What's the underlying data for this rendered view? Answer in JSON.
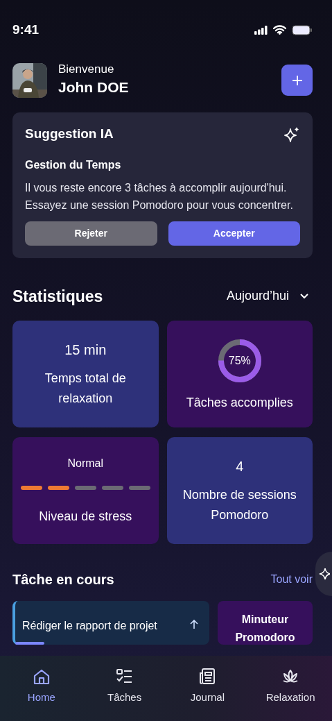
{
  "status_bar": {
    "time": "9:41"
  },
  "header": {
    "greeting": "Bienvenue",
    "name": "John DOE"
  },
  "suggestion": {
    "title": "Suggestion IA",
    "subtitle": "Gestion du Temps",
    "text": "Il vous reste encore 3 tâches à accomplir aujourd'hui. Essayez une session Pomodoro pour vous concentrer.",
    "buttons": [
      {
        "label": "Rejeter",
        "kind": "secondary"
      },
      {
        "label": "Accepter",
        "kind": "primary"
      }
    ]
  },
  "statistics": {
    "title": "Statistiques",
    "period": "Aujourd’hui",
    "cards": [
      {
        "kind": "value",
        "value": "15 min",
        "label": "Temps total de relaxation",
        "color": "#2e317a"
      },
      {
        "kind": "ring",
        "value": "75%",
        "label": "Tâches accomplies",
        "color": "#36105c"
      },
      {
        "kind": "segments",
        "value": "Normal",
        "level": 0.4,
        "label": "Niveau de stress",
        "color": "#36105c"
      },
      {
        "kind": "value",
        "value": "4",
        "label": "Nombre de sessions Pomodoro",
        "color": "#2e317a"
      }
    ]
  },
  "current_tasks": {
    "title": "Tâche en cours",
    "link": "Tout voir",
    "items": [
      {
        "kind": "task",
        "title": "Rédiger le rapport de projet",
        "level": 0.15
      },
      {
        "kind": "timer",
        "title": "Minuteur Promodoro"
      }
    ]
  },
  "bottom_nav": [
    {
      "label": "Home",
      "selected": true
    },
    {
      "label": "Tâches",
      "selected": false
    },
    {
      "label": "Journal",
      "selected": false
    },
    {
      "label": "Relaxation",
      "selected": false
    }
  ]
}
